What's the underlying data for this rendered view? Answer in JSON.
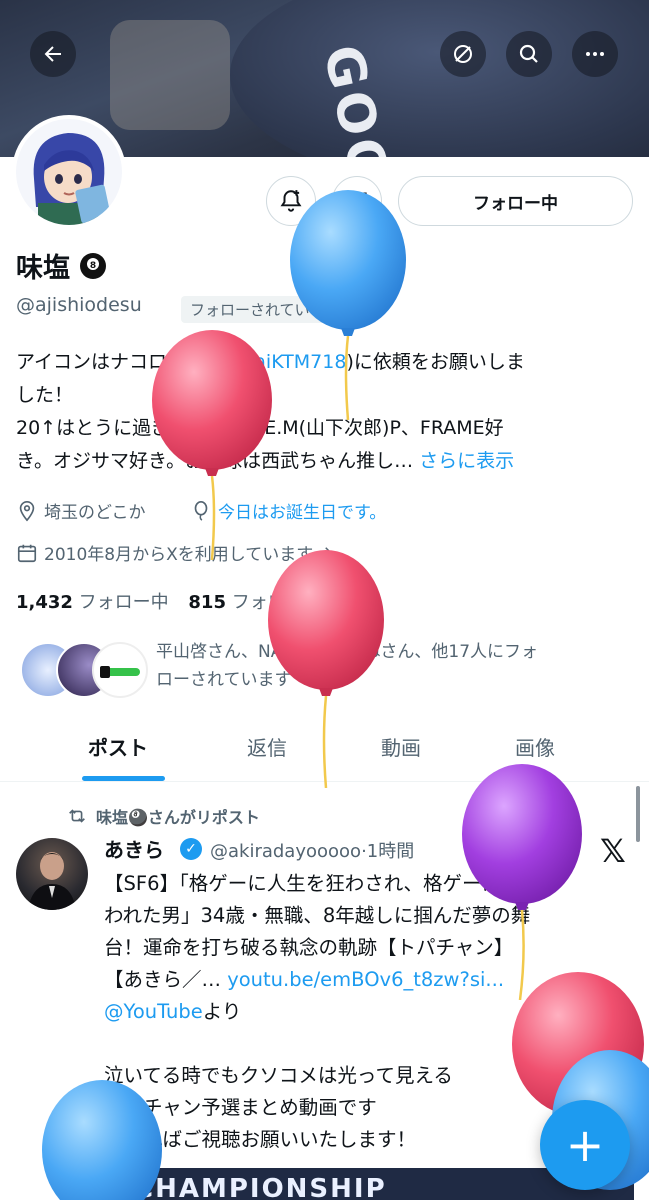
{
  "header": {
    "back_icon": "arrow-left-icon",
    "actions": [
      "verified-slash-icon",
      "search-icon",
      "more-icon"
    ],
    "banner_text": "GOODASOU"
  },
  "profile": {
    "name": "味塩",
    "handle": "@ajishiodesu",
    "follows_you": "フォローされています",
    "follow_button": "フォロー中",
    "bio_line1_a": "アイコンはナコロ様(",
    "bio_line1_link": "@kouraiKTM718",
    "bio_line1_b": ")に依頼をお願いしま",
    "bio_line2": "した！",
    "bio_line3": "20↑はとうに過ぎました。S.E.M(山下次郎)P、FRAME好",
    "bio_line4": "き。オジサマ好き。お野球は西武ちゃん推し…",
    "show_more": "さらに表示",
    "location": "埼玉のどこか",
    "birthday": "今日はお誕生日です。",
    "joined": "2010年8月からXを利用しています",
    "following_count": "1,432",
    "following_label": "フォロー中",
    "followers_count": "815",
    "followers_label": "フォロワー",
    "followed_by_line1": "平山啓さん、NAOさん、ぽねさん、他17人にフォ",
    "followed_by_line2": "ローされています"
  },
  "tabs": [
    {
      "label": "ポスト"
    },
    {
      "label": "返信"
    },
    {
      "label": "動画"
    },
    {
      "label": "画像"
    }
  ],
  "post": {
    "repost_by": "味塩🎱さんがリポスト",
    "author_name": "あきら",
    "author_handle": "@akiradayooooo",
    "time": "·1時間",
    "line1": "【SF6】「格ゲーに人生を狂わされ、格ゲーに救",
    "line2": "われた男」34歳・無職、8年越しに掴んだ夢の舞",
    "line3": "台！運命を打ち破る執念の軌跡【トパチャン】",
    "line4_a": "【あきら／… ",
    "line4_link": "youtu.be/emBOv6_t8zw?si...",
    "line5_link": "@YouTube",
    "line5_b": "より",
    "line6": "泣いてる時でもクソコメは光って見える",
    "line7": "トパチャン予選まとめ動画です",
    "line8": "良ければご視聴お願いいたします！",
    "card_text": "CHAMPIONSHIP"
  },
  "fab": {
    "label": "+"
  },
  "colors": {
    "accent": "#1d9bf0",
    "text": "#0f1419",
    "muted": "#536471",
    "balloon_blue": "#4aa8f5",
    "balloon_pink": "#f0506f",
    "balloon_purple": "#a23fe0"
  }
}
